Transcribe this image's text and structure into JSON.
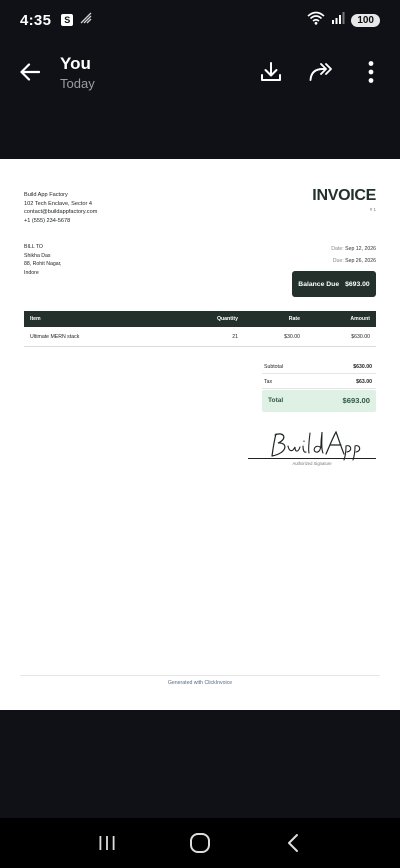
{
  "status_bar": {
    "time": "4:35",
    "s_badge": "S",
    "battery": "100"
  },
  "app_bar": {
    "title": "You",
    "subtitle": "Today"
  },
  "invoice": {
    "company": {
      "name": "Build App Factory",
      "address": "102 Tech Enclave, Sector 4",
      "email": "contact@buildappfactory.com",
      "phone": "+1 (555) 234-5678"
    },
    "title": "INVOICE",
    "number": "# 1",
    "bill_to": {
      "label": "BILL TO",
      "name": "Shikha Das",
      "address": "88, Rohit Nagar,",
      "city": "Indore"
    },
    "date_label": "Date:",
    "date": "Sep 12, 2026",
    "due_label": "Due:",
    "due": "Sep 26, 2026",
    "balance_label": "Balance Due",
    "balance_value": "$693.00",
    "table": {
      "headers": [
        "Item",
        "Quantity",
        "Rate",
        "Amount"
      ],
      "rows": [
        [
          "Ultimate MERN stack",
          "21",
          "$30.00",
          "$630.00"
        ]
      ]
    },
    "subtotal_label": "Subtotal",
    "subtotal_value": "$630.00",
    "tax_label": "Tax",
    "tax_value": "$63.00",
    "total_label": "Total",
    "total_value": "$693.00",
    "signature_text": "BuildApp",
    "signature_caption": "Authorized Signature",
    "footer": "Generated with ClickInvoice"
  },
  "colors": {
    "accent_dark": "#23302c",
    "total_bg": "#dff0e5",
    "total_text": "#2e5a44"
  },
  "icons": [
    "back-arrow-icon",
    "download-icon",
    "share-forward-icon",
    "more-vert-icon",
    "recents-icon",
    "home-icon",
    "nav-back-icon"
  ]
}
